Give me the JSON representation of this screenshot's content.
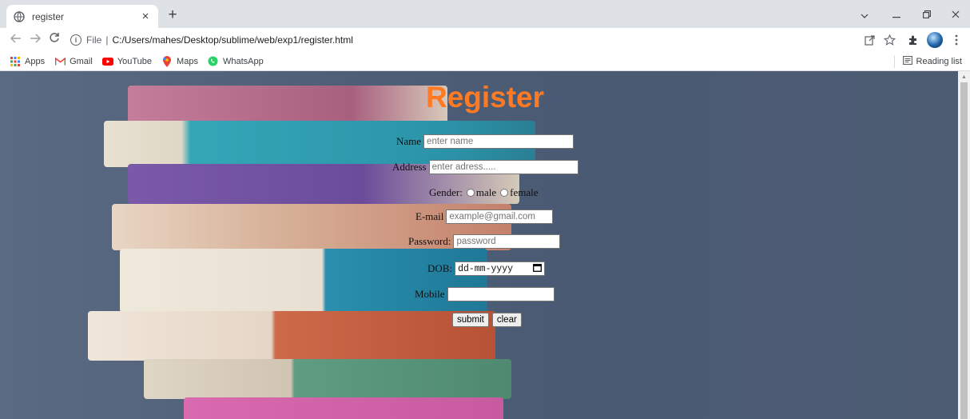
{
  "browser": {
    "tab_title": "register",
    "tab_close": "×",
    "new_tab": "+",
    "url_scheme": "File",
    "url_path": "C:/Users/mahes/Desktop/sublime/web/exp1/register.html",
    "bookmarks": [
      "Apps",
      "Gmail",
      "YouTube",
      "Maps",
      "WhatsApp"
    ],
    "reading_list": "Reading list"
  },
  "form": {
    "title": "Register",
    "name_label": "Name",
    "name_placeholder": "enter name",
    "address_label": "Address",
    "address_placeholder": "enter adress.....",
    "gender_label": "Gender:",
    "gender_options": [
      "male",
      "female"
    ],
    "email_label": "E-mail",
    "email_placeholder": "example@gmail.com",
    "password_label": "Password:",
    "password_placeholder": "password",
    "dob_label": "DOB:",
    "dob_placeholder": "dd-mm-yyyy",
    "mobile_label": "Mobile",
    "mobile_value": "",
    "submit_label": "submit",
    "clear_label": "clear"
  },
  "colors": {
    "title": "#ff7a22",
    "background": "#4f5f78"
  }
}
